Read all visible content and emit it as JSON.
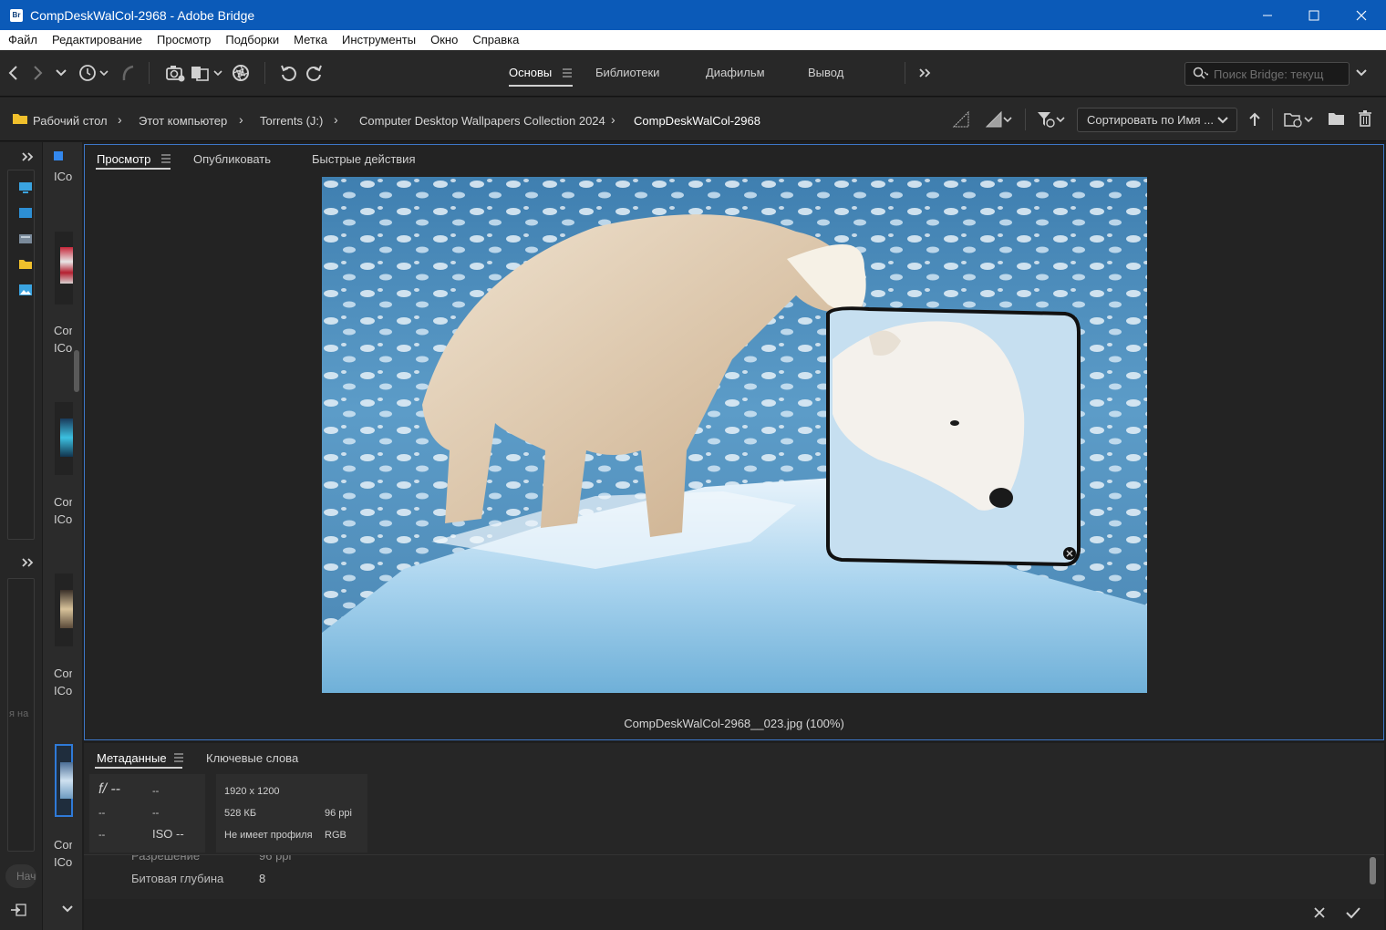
{
  "window": {
    "title": "CompDeskWalCol-2968 - Adobe Bridge",
    "logo": "Br"
  },
  "menu": [
    "Файл",
    "Редактирование",
    "Просмотр",
    "Подборки",
    "Метка",
    "Инструменты",
    "Окно",
    "Справка"
  ],
  "workspaces": {
    "tabs": [
      "Основы",
      "Библиотеки",
      "Диафильм",
      "Вывод"
    ],
    "active": "Основы"
  },
  "search": {
    "placeholder": "Поиск Bridge: текущ"
  },
  "breadcrumb": [
    "Рабочий стол",
    "Этот компьютер",
    "Torrents (J:)",
    "Computer Desktop Wallpapers Collection 2024",
    "CompDeskWalCol-2968"
  ],
  "sort": {
    "label": "Сортировать по Имя ..."
  },
  "content_items": [
    {
      "label1": "",
      "label2": "ICol"
    },
    {
      "label1": "Cor",
      "label2": "ICol"
    },
    {
      "label1": "Cor",
      "label2": "ICol"
    },
    {
      "label1": "Cor",
      "label2": "ICol"
    },
    {
      "label1": "Cor",
      "label2": "ICol"
    }
  ],
  "left_partial": {
    "text1": "я на",
    "text2": "Нач"
  },
  "preview": {
    "tabs": [
      "Просмотр",
      "Опубликовать",
      "Быстрые действия"
    ],
    "caption": "CompDeskWalCol-2968__023.jpg (100%)"
  },
  "metadata": {
    "tabs": [
      "Метаданные",
      "Ключевые слова"
    ],
    "camera": {
      "aperture": "f/ --",
      "shutter": "--",
      "ev": "--",
      "wb": "--",
      "focal": "--",
      "iso": "ISO --"
    },
    "file": {
      "dimensions": "1920 x 1200",
      "size": "528 КБ",
      "ppi": "96 ppi",
      "profile": "Не имеет профиля",
      "mode": "RGB"
    },
    "rows": [
      {
        "label": "Разрешение",
        "value": "96 ppi"
      },
      {
        "label": "Битовая глубина",
        "value": "8"
      }
    ]
  },
  "colors": {
    "titlebar": "#0b5ab8",
    "accent": "#3d77c8",
    "background": "#232323"
  }
}
